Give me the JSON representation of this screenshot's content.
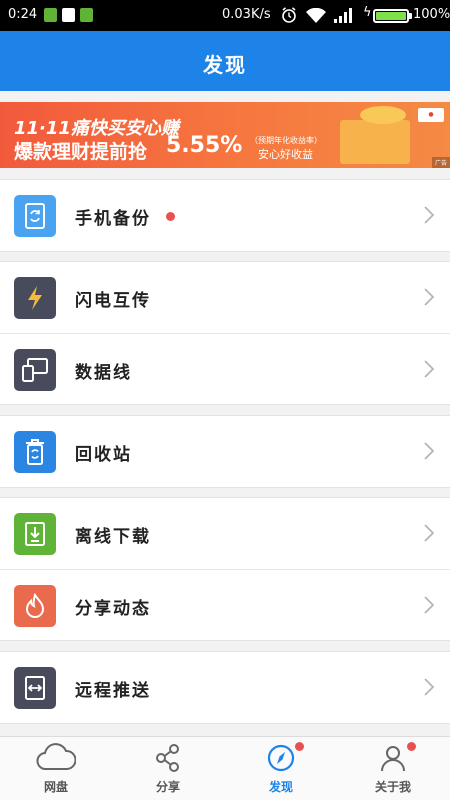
{
  "status_bar": {
    "time": "0:24",
    "speed": "0.03K/s",
    "battery": "100%",
    "battery_level": 1.0
  },
  "header": {
    "title": "发现"
  },
  "banner": {
    "line1": "11·11痛快买安心赚",
    "line2": "爆款理财提前抢",
    "rate": "5.55%",
    "note": "（预期年化收益率）",
    "sub": "安心好收益",
    "ad": "广告"
  },
  "menu": {
    "backup": {
      "label": "手机备份",
      "icon": "phone-sync-icon",
      "color": "#4aa3f0",
      "has_badge": true
    },
    "flash": {
      "label": "闪电互传",
      "icon": "lightning-icon",
      "color": "#484b5c"
    },
    "cable": {
      "label": "数据线",
      "icon": "devices-icon",
      "color": "#484b5c"
    },
    "recycle": {
      "label": "回收站",
      "icon": "recycle-bin-icon",
      "color": "#2a86e2"
    },
    "offline": {
      "label": "离线下载",
      "icon": "download-icon",
      "color": "#5fb336"
    },
    "share": {
      "label": "分享动态",
      "icon": "flame-icon",
      "color": "#ea6a4e"
    },
    "remote": {
      "label": "远程推送",
      "icon": "remote-push-icon",
      "color": "#484b5c"
    }
  },
  "tabs": {
    "disk": {
      "label": "网盘",
      "icon": "cloud-icon"
    },
    "share": {
      "label": "分享",
      "icon": "share-icon"
    },
    "discover": {
      "label": "发现",
      "icon": "compass-icon",
      "active": true,
      "has_badge": true
    },
    "about": {
      "label": "关于我",
      "icon": "person-icon",
      "has_badge": true
    }
  },
  "colors": {
    "accent": "#1e83e8",
    "badge": "#e95151",
    "status_bar": "#000000",
    "battery": "#7ee04a"
  }
}
